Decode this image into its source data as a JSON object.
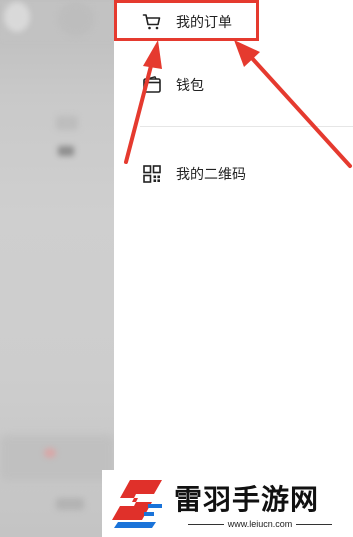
{
  "menu": {
    "items": [
      {
        "label": "我的订单",
        "icon": "cart-icon"
      },
      {
        "label": "钱包",
        "icon": "wallet-icon"
      },
      {
        "label": "我的二维码",
        "icon": "qrcode-icon"
      }
    ]
  },
  "annotation": {
    "highlight_color": "#e53a2f",
    "arrow_color": "#e53a2f"
  },
  "watermark": {
    "brand": "雷羽手游网",
    "url": "www.leiucn.com"
  }
}
